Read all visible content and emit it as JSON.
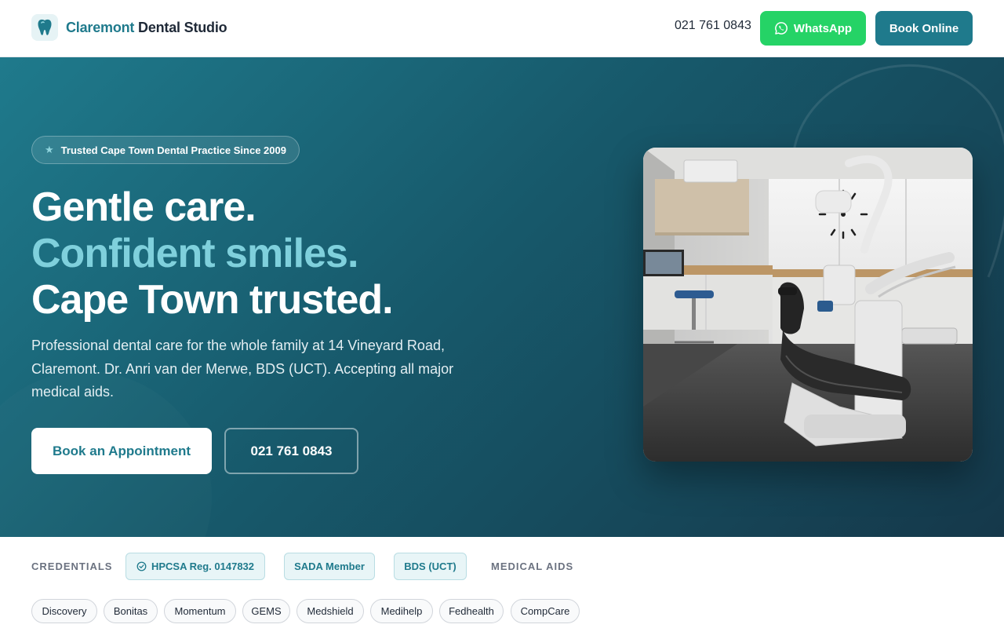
{
  "header": {
    "logo_accent": "Claremont",
    "logo_rest": "Dental Studio",
    "logo_icon": "tooth-icon",
    "phone": "021 761 0843",
    "whatsapp_label": "WhatsApp",
    "whatsapp_icon": "whatsapp-icon",
    "book_label": "Book Online"
  },
  "hero": {
    "badge": "Trusted Cape Town Dental Practice Since 2009",
    "badge_icon": "star-icon",
    "headline": [
      "Gentle care.",
      "Confident smiles.",
      "Cape Town trusted."
    ],
    "description": "Professional dental care for the whole family at 14 Vineyard Road, Claremont. Dr. Anri van der Merwe, BDS (UCT). Accepting all major medical aids.",
    "cta_primary": "Book an Appointment",
    "cta_secondary": "021 761 0843",
    "image_alt": "Modern dental treatment room with patient chair"
  },
  "credentials": {
    "label": "CREDENTIALS",
    "items": [
      "HPCSA Reg. 0147832",
      "SADA Member",
      "BDS (UCT)"
    ],
    "verified_icon": "check-circle-icon",
    "medical_aids_label": "MEDICAL AIDS",
    "medical_aids": [
      "Discovery",
      "Bonitas",
      "Momentum",
      "GEMS",
      "Medshield",
      "Medihelp",
      "Fedhealth",
      "CompCare"
    ]
  },
  "colors": {
    "brand": "#1f7a8c",
    "brand_light": "#7fd0dc",
    "whatsapp": "#25d366",
    "hero_dark": "#15384a"
  }
}
